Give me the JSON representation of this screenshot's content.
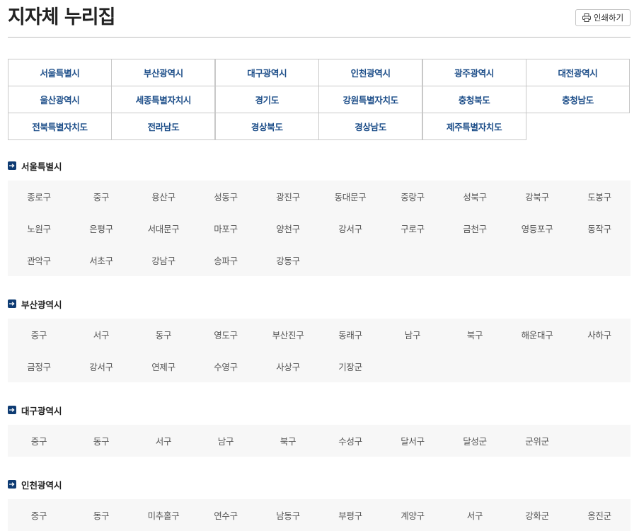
{
  "page": {
    "title": "지자체 누리집",
    "print_label": "인쇄하기"
  },
  "regions": [
    "서울특별시",
    "부산광역시",
    "대구광역시",
    "인천광역시",
    "광주광역시",
    "대전광역시",
    "울산광역시",
    "세종특별자치시",
    "경기도",
    "강원특별자치도",
    "충청북도",
    "충청남도",
    "전북특별자치도",
    "전라남도",
    "경상북도",
    "경상남도",
    "제주특별자치도"
  ],
  "sections": [
    {
      "title": "서울특별시",
      "districts": [
        "종로구",
        "중구",
        "용산구",
        "성동구",
        "광진구",
        "동대문구",
        "중랑구",
        "성북구",
        "강북구",
        "도봉구",
        "노원구",
        "은평구",
        "서대문구",
        "마포구",
        "양천구",
        "강서구",
        "구로구",
        "금천구",
        "영등포구",
        "동작구",
        "관악구",
        "서초구",
        "강남구",
        "송파구",
        "강동구"
      ]
    },
    {
      "title": "부산광역시",
      "districts": [
        "중구",
        "서구",
        "동구",
        "영도구",
        "부산진구",
        "동래구",
        "남구",
        "북구",
        "해운대구",
        "사하구",
        "금정구",
        "강서구",
        "연제구",
        "수영구",
        "사상구",
        "기장군"
      ]
    },
    {
      "title": "대구광역시",
      "districts": [
        "중구",
        "동구",
        "서구",
        "남구",
        "북구",
        "수성구",
        "달서구",
        "달성군",
        "군위군"
      ]
    },
    {
      "title": "인천광역시",
      "districts": [
        "중구",
        "동구",
        "미추홀구",
        "연수구",
        "남동구",
        "부평구",
        "계양구",
        "서구",
        "강화군",
        "옹진군"
      ]
    }
  ]
}
